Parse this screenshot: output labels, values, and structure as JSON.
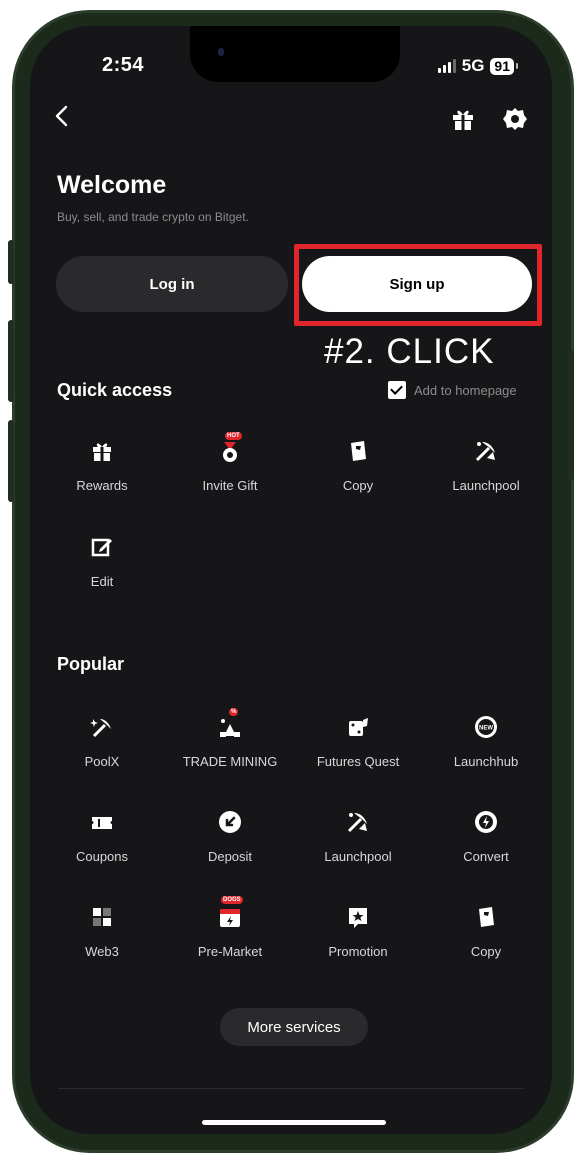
{
  "status_bar": {
    "time": "2:54",
    "network": "5G",
    "battery": "91"
  },
  "header": {
    "back_icon": "chevron-left-icon",
    "gift_icon": "gift-icon",
    "settings_icon": "gear-icon"
  },
  "welcome": {
    "title": "Welcome",
    "subtitle": "Buy, sell, and trade crypto on Bitget.",
    "login_label": "Log in",
    "signup_label": "Sign up"
  },
  "annotation": {
    "text": "#2. CLICK",
    "color": "#e0262b"
  },
  "quick_access": {
    "title": "Quick access",
    "add_to_homepage": "Add to homepage",
    "items": [
      {
        "label": "Rewards",
        "icon": "gift-icon"
      },
      {
        "label": "Invite Gift",
        "icon": "medal-icon",
        "badge": "HOT"
      },
      {
        "label": "Copy",
        "icon": "copy-card-icon"
      },
      {
        "label": "Launchpool",
        "icon": "pickaxe-icon"
      },
      {
        "label": "Edit",
        "icon": "edit-icon"
      }
    ]
  },
  "popular": {
    "title": "Popular",
    "items": [
      {
        "label": "PoolX",
        "icon": "pickaxe-sparkle-icon"
      },
      {
        "label": "TRADE MINING",
        "icon": "mining-icon",
        "badge": "%"
      },
      {
        "label": "Futures Quest",
        "icon": "dice-icon"
      },
      {
        "label": "Launchhub",
        "icon": "new-badge-icon"
      },
      {
        "label": "Coupons",
        "icon": "coupon-icon"
      },
      {
        "label": "Deposit",
        "icon": "deposit-icon"
      },
      {
        "label": "Launchpool",
        "icon": "pickaxe-icon"
      },
      {
        "label": "Convert",
        "icon": "convert-icon"
      },
      {
        "label": "Web3",
        "icon": "web3-icon"
      },
      {
        "label": "Pre-Market",
        "icon": "calendar-icon",
        "badge": "DOGS"
      },
      {
        "label": "Promotion",
        "icon": "star-flag-icon"
      },
      {
        "label": "Copy",
        "icon": "copy-card-icon"
      }
    ],
    "more_label": "More services"
  },
  "colors": {
    "background": "#161618",
    "button_dark": "#2a2a2d",
    "highlight": "#e0262b"
  }
}
